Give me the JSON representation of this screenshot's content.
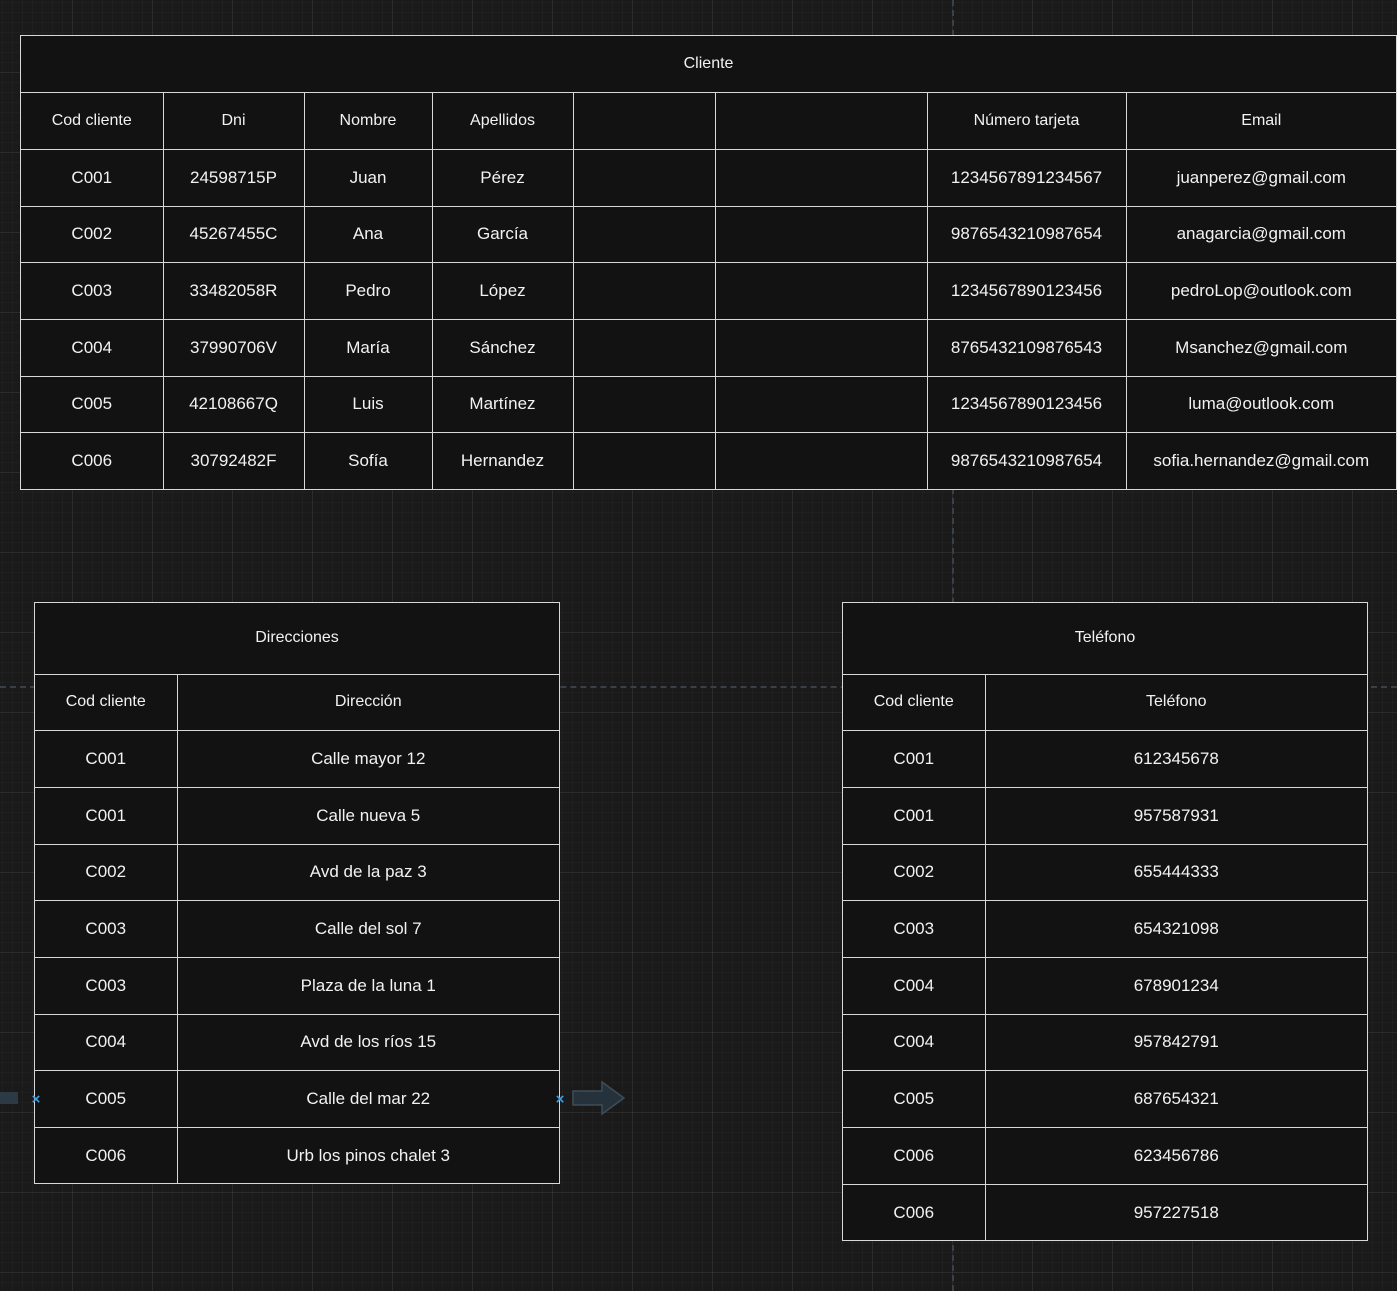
{
  "cliente": {
    "title": "Cliente",
    "headers": [
      "Cod cliente",
      "Dni",
      "Nombre",
      "Apellidos",
      "",
      "",
      "Número tarjeta",
      "Email"
    ],
    "rows": [
      [
        "C001",
        "24598715P",
        "Juan",
        "Pérez",
        "",
        "",
        "1234567891234567",
        "juanperez@gmail.com"
      ],
      [
        "C002",
        "45267455C",
        "Ana",
        "García",
        "",
        "",
        "9876543210987654",
        "anagarcia@gmail.com"
      ],
      [
        "C003",
        "33482058R",
        "Pedro",
        "López",
        "",
        "",
        "1234567890123456",
        "pedroLop@outlook.com"
      ],
      [
        "C004",
        "37990706V",
        "María",
        "Sánchez",
        "",
        "",
        "8765432109876543",
        "Msanchez@gmail.com"
      ],
      [
        "C005",
        "42108667Q",
        "Luis",
        "Martínez",
        "",
        "",
        "1234567890123456",
        "luma@outlook.com"
      ],
      [
        "C006",
        "30792482F",
        "Sofía",
        "Hernandez",
        "",
        "",
        "9876543210987654",
        "sofia.hernandez@gmail.com"
      ]
    ]
  },
  "direcciones": {
    "title": "Direcciones",
    "headers": [
      "Cod cliente",
      "Dirección"
    ],
    "rows": [
      [
        "C001",
        "Calle mayor 12"
      ],
      [
        "C001",
        "Calle nueva 5"
      ],
      [
        "C002",
        "Avd de la paz 3"
      ],
      [
        "C003",
        "Calle del sol 7"
      ],
      [
        "C003",
        "Plaza de la luna 1"
      ],
      [
        "C004",
        "Avd de los ríos 15"
      ],
      [
        "C005",
        "Calle del mar 22"
      ],
      [
        "C006",
        "Urb los pinos chalet 3"
      ]
    ]
  },
  "telefono": {
    "title": "Teléfono",
    "headers": [
      "Cod cliente",
      "Teléfono"
    ],
    "rows": [
      [
        "C001",
        "612345678"
      ],
      [
        "C001",
        "957587931"
      ],
      [
        "C002",
        "655444333"
      ],
      [
        "C003",
        "654321098"
      ],
      [
        "C004",
        "678901234"
      ],
      [
        "C004",
        "957842791"
      ],
      [
        "C005",
        "687654321"
      ],
      [
        "C006",
        "623456786"
      ],
      [
        "C006",
        "957227518"
      ]
    ]
  },
  "icons": {
    "handle": "×",
    "handle_name": "connection-handle-icon",
    "arrow_name": "arrow-right-icon",
    "accent_color": "#3aa0e8",
    "background_color": "#1a1a1a",
    "table_background": "#121212",
    "border_color": "#d8d8d8"
  }
}
